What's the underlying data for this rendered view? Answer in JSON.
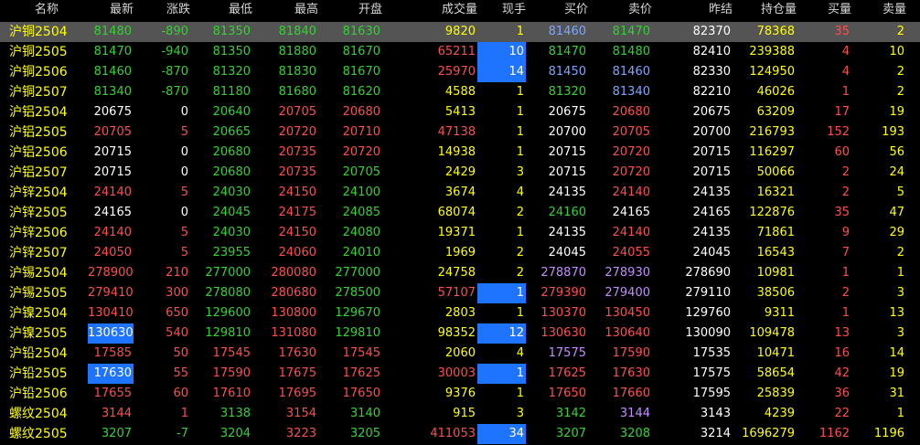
{
  "colors": {
    "up": "#ff4d4d",
    "down": "#2fd42f",
    "flat": "#ffffff",
    "name": "#ffff00",
    "volume": "#ffff00",
    "position": "#ffff00",
    "hand": "#ffff00",
    "bid_vol": "#ff4d4d",
    "ask_vol": "#ffff00",
    "header": "#d6d6d6",
    "purple": "#c38cff",
    "blue": "#7ea6ff",
    "highlight_bg": "#1e73ff",
    "selected_row_bg": "#545454"
  },
  "header": {
    "name": "名称",
    "last": "最新",
    "change": "涨跌",
    "low": "最低",
    "high": "最高",
    "open": "开盘",
    "volume": "成交量",
    "hand": "现手",
    "bid": "买价",
    "ask": "卖价",
    "prev": "昨结",
    "position": "持仓量",
    "bid_vol": "买量",
    "ask_vol": "卖量"
  },
  "rows": [
    {
      "name": "沪铜2504",
      "last": "81480",
      "change": "-890",
      "low": "81350",
      "high": "81840",
      "open": "81630",
      "volume": "9820",
      "hand": "1",
      "bid": "81460",
      "ask": "81470",
      "prev": "82370",
      "position": "78368",
      "bid_vol": "35",
      "ask_vol": "2",
      "c": {
        "last": "down",
        "change": "down",
        "low": "down",
        "high": "down",
        "open": "down",
        "bid": "blue",
        "ask": "down"
      }
    },
    {
      "name": "沪铜2505",
      "last": "81470",
      "change": "-940",
      "low": "81350",
      "high": "81880",
      "open": "81670",
      "volume": "65211",
      "hand": "10",
      "bid": "81470",
      "ask": "81480",
      "prev": "82410",
      "position": "239388",
      "bid_vol": "4",
      "ask_vol": "10",
      "c": {
        "last": "down",
        "change": "down",
        "low": "down",
        "high": "down",
        "open": "down",
        "bid": "down",
        "ask": "down",
        "volume": "up"
      }
    },
    {
      "name": "沪铜2506",
      "last": "81460",
      "change": "-870",
      "low": "81320",
      "high": "81830",
      "open": "81670",
      "volume": "25970",
      "hand": "14",
      "bid": "81450",
      "ask": "81460",
      "prev": "82330",
      "position": "124950",
      "bid_vol": "4",
      "ask_vol": "2",
      "c": {
        "last": "down",
        "change": "down",
        "low": "down",
        "high": "down",
        "open": "down",
        "bid": "blue",
        "ask": "blue",
        "volume": "up"
      }
    },
    {
      "name": "沪铜2507",
      "last": "81340",
      "change": "-870",
      "low": "81180",
      "high": "81680",
      "open": "81620",
      "volume": "4588",
      "hand": "1",
      "bid": "81320",
      "ask": "81340",
      "prev": "82210",
      "position": "46026",
      "bid_vol": "1",
      "ask_vol": "2",
      "c": {
        "last": "down",
        "change": "down",
        "low": "down",
        "high": "down",
        "open": "down",
        "bid": "down",
        "ask": "blue"
      }
    },
    {
      "name": "沪铝2504",
      "last": "20675",
      "change": "0",
      "low": "20640",
      "high": "20705",
      "open": "20680",
      "volume": "5413",
      "hand": "1",
      "bid": "20675",
      "ask": "20680",
      "prev": "20675",
      "position": "63209",
      "bid_vol": "17",
      "ask_vol": "19",
      "c": {
        "last": "flat",
        "change": "flat",
        "low": "down",
        "high": "up",
        "open": "up",
        "bid": "flat",
        "ask": "up"
      }
    },
    {
      "name": "沪铝2505",
      "last": "20705",
      "change": "5",
      "low": "20665",
      "high": "20720",
      "open": "20710",
      "volume": "47138",
      "hand": "1",
      "bid": "20700",
      "ask": "20705",
      "prev": "20700",
      "position": "216793",
      "bid_vol": "152",
      "ask_vol": "193",
      "c": {
        "last": "up",
        "change": "up",
        "low": "down",
        "high": "up",
        "open": "up",
        "bid": "flat",
        "ask": "up",
        "volume": "up"
      }
    },
    {
      "name": "沪铝2506",
      "last": "20715",
      "change": "0",
      "low": "20680",
      "high": "20735",
      "open": "20720",
      "volume": "14938",
      "hand": "1",
      "bid": "20715",
      "ask": "20720",
      "prev": "20715",
      "position": "116297",
      "bid_vol": "60",
      "ask_vol": "56",
      "c": {
        "last": "flat",
        "change": "flat",
        "low": "down",
        "high": "up",
        "open": "up",
        "bid": "flat",
        "ask": "up"
      }
    },
    {
      "name": "沪铝2507",
      "last": "20715",
      "change": "0",
      "low": "20680",
      "high": "20735",
      "open": "20705",
      "volume": "2429",
      "hand": "3",
      "bid": "20715",
      "ask": "20720",
      "prev": "20715",
      "position": "50066",
      "bid_vol": "2",
      "ask_vol": "24",
      "c": {
        "last": "flat",
        "change": "flat",
        "low": "down",
        "high": "up",
        "open": "down",
        "bid": "flat",
        "ask": "up"
      }
    },
    {
      "name": "沪锌2504",
      "last": "24140",
      "change": "5",
      "low": "24030",
      "high": "24150",
      "open": "24100",
      "volume": "3674",
      "hand": "4",
      "bid": "24135",
      "ask": "24140",
      "prev": "24135",
      "position": "16321",
      "bid_vol": "2",
      "ask_vol": "5",
      "c": {
        "last": "up",
        "change": "up",
        "low": "down",
        "high": "up",
        "open": "down",
        "bid": "flat",
        "ask": "up"
      }
    },
    {
      "name": "沪锌2505",
      "last": "24165",
      "change": "0",
      "low": "24045",
      "high": "24175",
      "open": "24085",
      "volume": "68074",
      "hand": "2",
      "bid": "24160",
      "ask": "24165",
      "prev": "24165",
      "position": "122876",
      "bid_vol": "35",
      "ask_vol": "47",
      "c": {
        "last": "flat",
        "change": "flat",
        "low": "down",
        "high": "up",
        "open": "down",
        "bid": "down",
        "ask": "flat"
      }
    },
    {
      "name": "沪锌2506",
      "last": "24140",
      "change": "5",
      "low": "24030",
      "high": "24150",
      "open": "24080",
      "volume": "19371",
      "hand": "1",
      "bid": "24135",
      "ask": "24140",
      "prev": "24135",
      "position": "71861",
      "bid_vol": "9",
      "ask_vol": "29",
      "c": {
        "last": "up",
        "change": "up",
        "low": "down",
        "high": "up",
        "open": "down",
        "bid": "flat",
        "ask": "up"
      }
    },
    {
      "name": "沪锌2507",
      "last": "24050",
      "change": "5",
      "low": "23955",
      "high": "24060",
      "open": "24010",
      "volume": "1969",
      "hand": "2",
      "bid": "24045",
      "ask": "24055",
      "prev": "24045",
      "position": "16543",
      "bid_vol": "7",
      "ask_vol": "2",
      "c": {
        "last": "up",
        "change": "up",
        "low": "down",
        "high": "up",
        "open": "down",
        "bid": "flat",
        "ask": "up"
      }
    },
    {
      "name": "沪锡2504",
      "last": "278900",
      "change": "210",
      "low": "277000",
      "high": "280080",
      "open": "277000",
      "volume": "24758",
      "hand": "2",
      "bid": "278870",
      "ask": "278930",
      "prev": "278690",
      "position": "10981",
      "bid_vol": "1",
      "ask_vol": "1",
      "c": {
        "last": "up",
        "change": "up",
        "low": "down",
        "high": "up",
        "open": "down",
        "bid": "purple",
        "ask": "purple"
      }
    },
    {
      "name": "沪锡2505",
      "last": "279410",
      "change": "300",
      "low": "278080",
      "high": "280680",
      "open": "278500",
      "volume": "57107",
      "hand": "1",
      "bid": "279390",
      "ask": "279400",
      "prev": "279110",
      "position": "38506",
      "bid_vol": "2",
      "ask_vol": "3",
      "c": {
        "last": "up",
        "change": "up",
        "low": "down",
        "high": "up",
        "open": "down",
        "bid": "up",
        "ask": "purple",
        "volume": "up"
      }
    },
    {
      "name": "沪镍2504",
      "last": "130410",
      "change": "650",
      "low": "129600",
      "high": "130800",
      "open": "129670",
      "volume": "2803",
      "hand": "1",
      "bid": "130370",
      "ask": "130450",
      "prev": "129760",
      "position": "9311",
      "bid_vol": "1",
      "ask_vol": "13",
      "c": {
        "last": "up",
        "change": "up",
        "low": "down",
        "high": "up",
        "open": "down",
        "bid": "up",
        "ask": "up"
      }
    },
    {
      "name": "沪镍2505",
      "last": "130630",
      "change": "540",
      "low": "129810",
      "high": "131080",
      "open": "129810",
      "volume": "98352",
      "hand": "12",
      "bid": "130630",
      "ask": "130640",
      "prev": "130090",
      "position": "109478",
      "bid_vol": "13",
      "ask_vol": "3",
      "c": {
        "last": "up",
        "change": "up",
        "low": "down",
        "high": "up",
        "open": "down",
        "bid": "up",
        "ask": "up"
      }
    },
    {
      "name": "沪铅2504",
      "last": "17585",
      "change": "50",
      "low": "17545",
      "high": "17630",
      "open": "17545",
      "volume": "2060",
      "hand": "4",
      "bid": "17575",
      "ask": "17590",
      "prev": "17535",
      "position": "10471",
      "bid_vol": "16",
      "ask_vol": "14",
      "c": {
        "last": "up",
        "change": "up",
        "low": "up",
        "high": "up",
        "open": "up",
        "bid": "purple",
        "ask": "up"
      }
    },
    {
      "name": "沪铅2505",
      "last": "17630",
      "change": "55",
      "low": "17590",
      "high": "17675",
      "open": "17625",
      "volume": "30003",
      "hand": "1",
      "bid": "17625",
      "ask": "17630",
      "prev": "17575",
      "position": "58654",
      "bid_vol": "42",
      "ask_vol": "19",
      "c": {
        "last": "up",
        "change": "up",
        "low": "up",
        "high": "up",
        "open": "up",
        "bid": "up",
        "ask": "up",
        "volume": "up"
      }
    },
    {
      "name": "沪铅2506",
      "last": "17655",
      "change": "60",
      "low": "17610",
      "high": "17695",
      "open": "17650",
      "volume": "9376",
      "hand": "1",
      "bid": "17650",
      "ask": "17660",
      "prev": "17595",
      "position": "25839",
      "bid_vol": "36",
      "ask_vol": "31",
      "c": {
        "last": "up",
        "change": "up",
        "low": "up",
        "high": "up",
        "open": "up",
        "bid": "up",
        "ask": "up"
      }
    },
    {
      "name": "螺纹2504",
      "last": "3144",
      "change": "1",
      "low": "3138",
      "high": "3154",
      "open": "3140",
      "volume": "915",
      "hand": "3",
      "bid": "3142",
      "ask": "3144",
      "prev": "3143",
      "position": "4239",
      "bid_vol": "22",
      "ask_vol": "1",
      "c": {
        "last": "up",
        "change": "up",
        "low": "down",
        "high": "up",
        "open": "down",
        "bid": "down",
        "ask": "purple"
      }
    },
    {
      "name": "螺纹2505",
      "last": "3207",
      "change": "-7",
      "low": "3204",
      "high": "3223",
      "open": "3205",
      "volume": "411053",
      "hand": "34",
      "bid": "3207",
      "ask": "3208",
      "prev": "3214",
      "position": "1696279",
      "bid_vol": "1162",
      "ask_vol": "1196",
      "c": {
        "last": "down",
        "change": "down",
        "low": "down",
        "high": "up",
        "open": "down",
        "bid": "down",
        "ask": "down",
        "volume": "up"
      }
    }
  ],
  "state": {
    "selected_row": 0,
    "highlighted_cells": [
      {
        "row": 1,
        "field": "hand"
      },
      {
        "row": 2,
        "field": "hand"
      },
      {
        "row": 13,
        "field": "hand"
      },
      {
        "row": 15,
        "field": "last"
      },
      {
        "row": 15,
        "field": "hand"
      },
      {
        "row": 17,
        "field": "last"
      },
      {
        "row": 17,
        "field": "hand"
      },
      {
        "row": 20,
        "field": "hand"
      }
    ]
  }
}
